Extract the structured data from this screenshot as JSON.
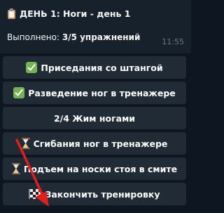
{
  "message": {
    "title_icon": "clipboard-icon",
    "title": "ДЕНЬ 1: Ноги - день 1",
    "progress_label": "Выполнено: ",
    "progress_value": "3/5 упражнений",
    "time": "11:55"
  },
  "keyboard": {
    "buttons": [
      {
        "label": "Приседания со штангой",
        "icon": "check-mark-icon",
        "status": "done"
      },
      {
        "label": "Разведение ног в тренажере",
        "icon": "check-mark-icon",
        "status": "done"
      },
      {
        "label": "2/4 Жим ногами",
        "icon": null,
        "status": "in-progress"
      },
      {
        "label": "Сгибания ног в тренажере",
        "icon": "hourglass-icon",
        "status": "pending"
      },
      {
        "label": "Подъем на носки стоя в смите",
        "icon": "hourglass-icon",
        "status": "pending"
      },
      {
        "label": "Закончить тренировку",
        "icon": "checkered-flag-icon",
        "status": "action"
      }
    ]
  },
  "colors": {
    "chat_background": "#0e1621",
    "bubble_background": "#17212b",
    "button_background": "#202b36",
    "annotation_arrow": "#e01e1e"
  }
}
